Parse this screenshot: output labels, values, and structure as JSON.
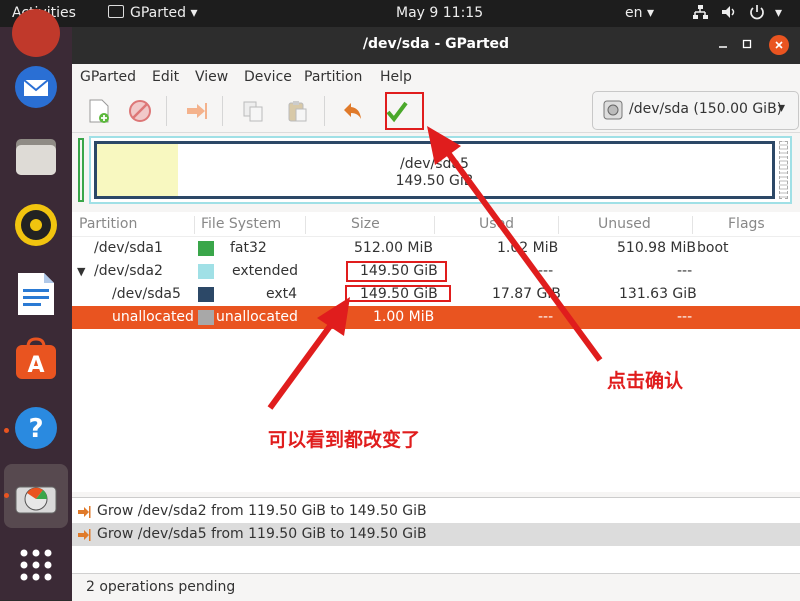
{
  "topbar": {
    "activities": "Activities",
    "app_name": "GParted",
    "clock": "May 9  11:15",
    "lang": "en"
  },
  "window": {
    "title": "/dev/sda - GParted"
  },
  "menu": [
    "GParted",
    "Edit",
    "View",
    "Device",
    "Partition",
    "Help"
  ],
  "device_selector": "/dev/sda (150.00 GiB)",
  "graph": {
    "partition_name": "/dev/sda5",
    "partition_size": "149.50 GiB",
    "used_fraction": 0.12
  },
  "columns": [
    "Partition",
    "File System",
    "Size",
    "Used",
    "Unused",
    "Flags"
  ],
  "rows": [
    {
      "partition": "/dev/sda1",
      "fs": "fat32",
      "size": "512.00 MiB",
      "used": "1.02 MiB",
      "unused": "510.98 MiB",
      "flags": "boot",
      "color": "#3aa64a"
    },
    {
      "partition": "/dev/sda2",
      "fs": "extended",
      "size": "149.50 GiB",
      "used": "---",
      "unused": "---",
      "flags": "",
      "color": "#a0e0e6"
    },
    {
      "partition": "/dev/sda5",
      "fs": "ext4",
      "size": "149.50 GiB",
      "used": "17.87 GiB",
      "unused": "131.63 GiB",
      "flags": "",
      "color": "#2c4867"
    },
    {
      "partition": "unallocated",
      "fs": "unallocated",
      "size": "1.00 MiB",
      "used": "---",
      "unused": "---",
      "flags": "",
      "color": "#a8a8a8"
    }
  ],
  "operations": [
    "Grow /dev/sda2 from 119.50 GiB to 149.50 GiB",
    "Grow /dev/sda5 from 119.50 GiB to 149.50 GiB"
  ],
  "status": "2 operations pending",
  "annotations": {
    "confirm": "点击确认",
    "changed": "可以看到都改变了"
  },
  "colors": {
    "selection": "#e95420",
    "highlight": "#e01d1d",
    "accent": "#3aa64a"
  }
}
